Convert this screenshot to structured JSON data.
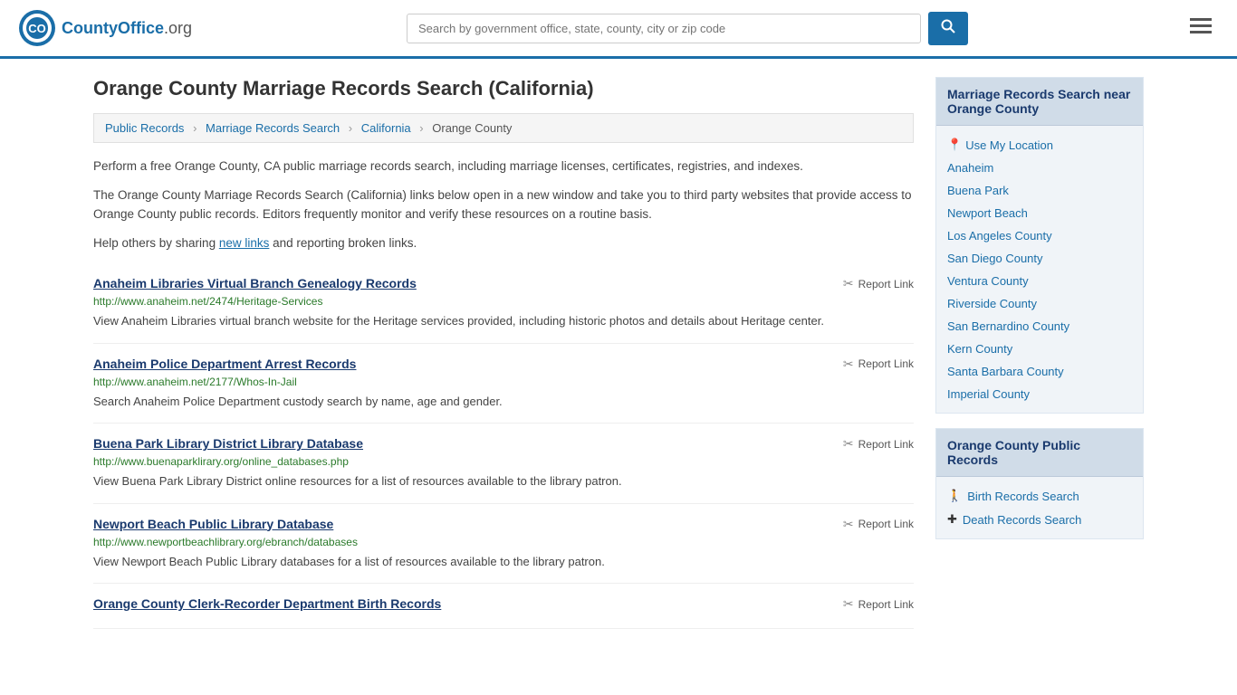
{
  "header": {
    "logo_text": "CountyOffice",
    "logo_suffix": ".org",
    "search_placeholder": "Search by government office, state, county, city or zip code",
    "search_button_label": "🔍"
  },
  "page": {
    "title": "Orange County Marriage Records Search (California)"
  },
  "breadcrumb": {
    "items": [
      "Public Records",
      "Marriage Records Search",
      "California",
      "Orange County"
    ]
  },
  "descriptions": [
    "Perform a free Orange County, CA public marriage records search, including marriage licenses, certificates, registries, and indexes.",
    "The Orange County Marriage Records Search (California) links below open in a new window and take you to third party websites that provide access to Orange County public records. Editors frequently monitor and verify these resources on a routine basis.",
    "Help others by sharing new links and reporting broken links."
  ],
  "records": [
    {
      "title": "Anaheim Libraries Virtual Branch Genealogy Records",
      "url": "http://www.anaheim.net/2474/Heritage-Services",
      "description": "View Anaheim Libraries virtual branch website for the Heritage services provided, including historic photos and details about Heritage center."
    },
    {
      "title": "Anaheim Police Department Arrest Records",
      "url": "http://www.anaheim.net/2177/Whos-In-Jail",
      "description": "Search Anaheim Police Department custody search by name, age and gender."
    },
    {
      "title": "Buena Park Library District Library Database",
      "url": "http://www.buenaparklirary.org/online_databases.php",
      "description": "View Buena Park Library District online resources for a list of resources available to the library patron."
    },
    {
      "title": "Newport Beach Public Library Database",
      "url": "http://www.newportbeachlibrary.org/ebranch/databases",
      "description": "View Newport Beach Public Library databases for a list of resources available to the library patron."
    },
    {
      "title": "Orange County Clerk-Recorder Department Birth Records",
      "url": "",
      "description": ""
    }
  ],
  "report_link_label": "Report Link",
  "new_links_text": "new links",
  "sidebar": {
    "nearby_title": "Marriage Records Search near Orange County",
    "location_link": "Use My Location",
    "nearby_links": [
      "Anaheim",
      "Buena Park",
      "Newport Beach",
      "Los Angeles County",
      "San Diego County",
      "Ventura County",
      "Riverside County",
      "San Bernardino County",
      "Kern County",
      "Santa Barbara County",
      "Imperial County"
    ],
    "public_records_title": "Orange County Public Records",
    "public_records_links": [
      "Birth Records Search",
      "Death Records Search"
    ]
  }
}
